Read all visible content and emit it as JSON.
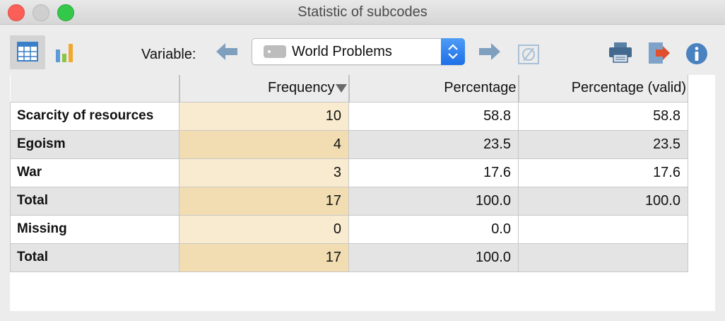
{
  "window": {
    "title": "Statistic of subcodes"
  },
  "toolbar": {
    "variable_label": "Variable:",
    "selected_variable": "World Problems",
    "icons": [
      "table-view-icon",
      "bar-chart-icon",
      "arrow-left-icon",
      "tag-icon",
      "select-stepper-icon",
      "arrow-right-icon",
      "clear-filter-icon",
      "printer-icon",
      "export-icon",
      "info-icon"
    ]
  },
  "table": {
    "columns": [
      "Frequency",
      "Percentage",
      "Percentage (valid)"
    ],
    "rows": [
      {
        "label": "Scarcity of resources",
        "frequency": "10",
        "percentage": "58.8",
        "valid": "58.8"
      },
      {
        "label": "Egoism",
        "frequency": "4",
        "percentage": "23.5",
        "valid": "23.5"
      },
      {
        "label": "War",
        "frequency": "3",
        "percentage": "17.6",
        "valid": "17.6"
      },
      {
        "label": "Total",
        "frequency": "17",
        "percentage": "100.0",
        "valid": "100.0"
      },
      {
        "label": "Missing",
        "frequency": "0",
        "percentage": "0.0",
        "valid": ""
      },
      {
        "label": "Total",
        "frequency": "17",
        "percentage": "100.0",
        "valid": ""
      }
    ]
  },
  "colors": {
    "frequency_highlight": "#f9ebd0",
    "frequency_highlight_alt": "#f1ddb1",
    "row_alt": "#e4e4e4"
  }
}
